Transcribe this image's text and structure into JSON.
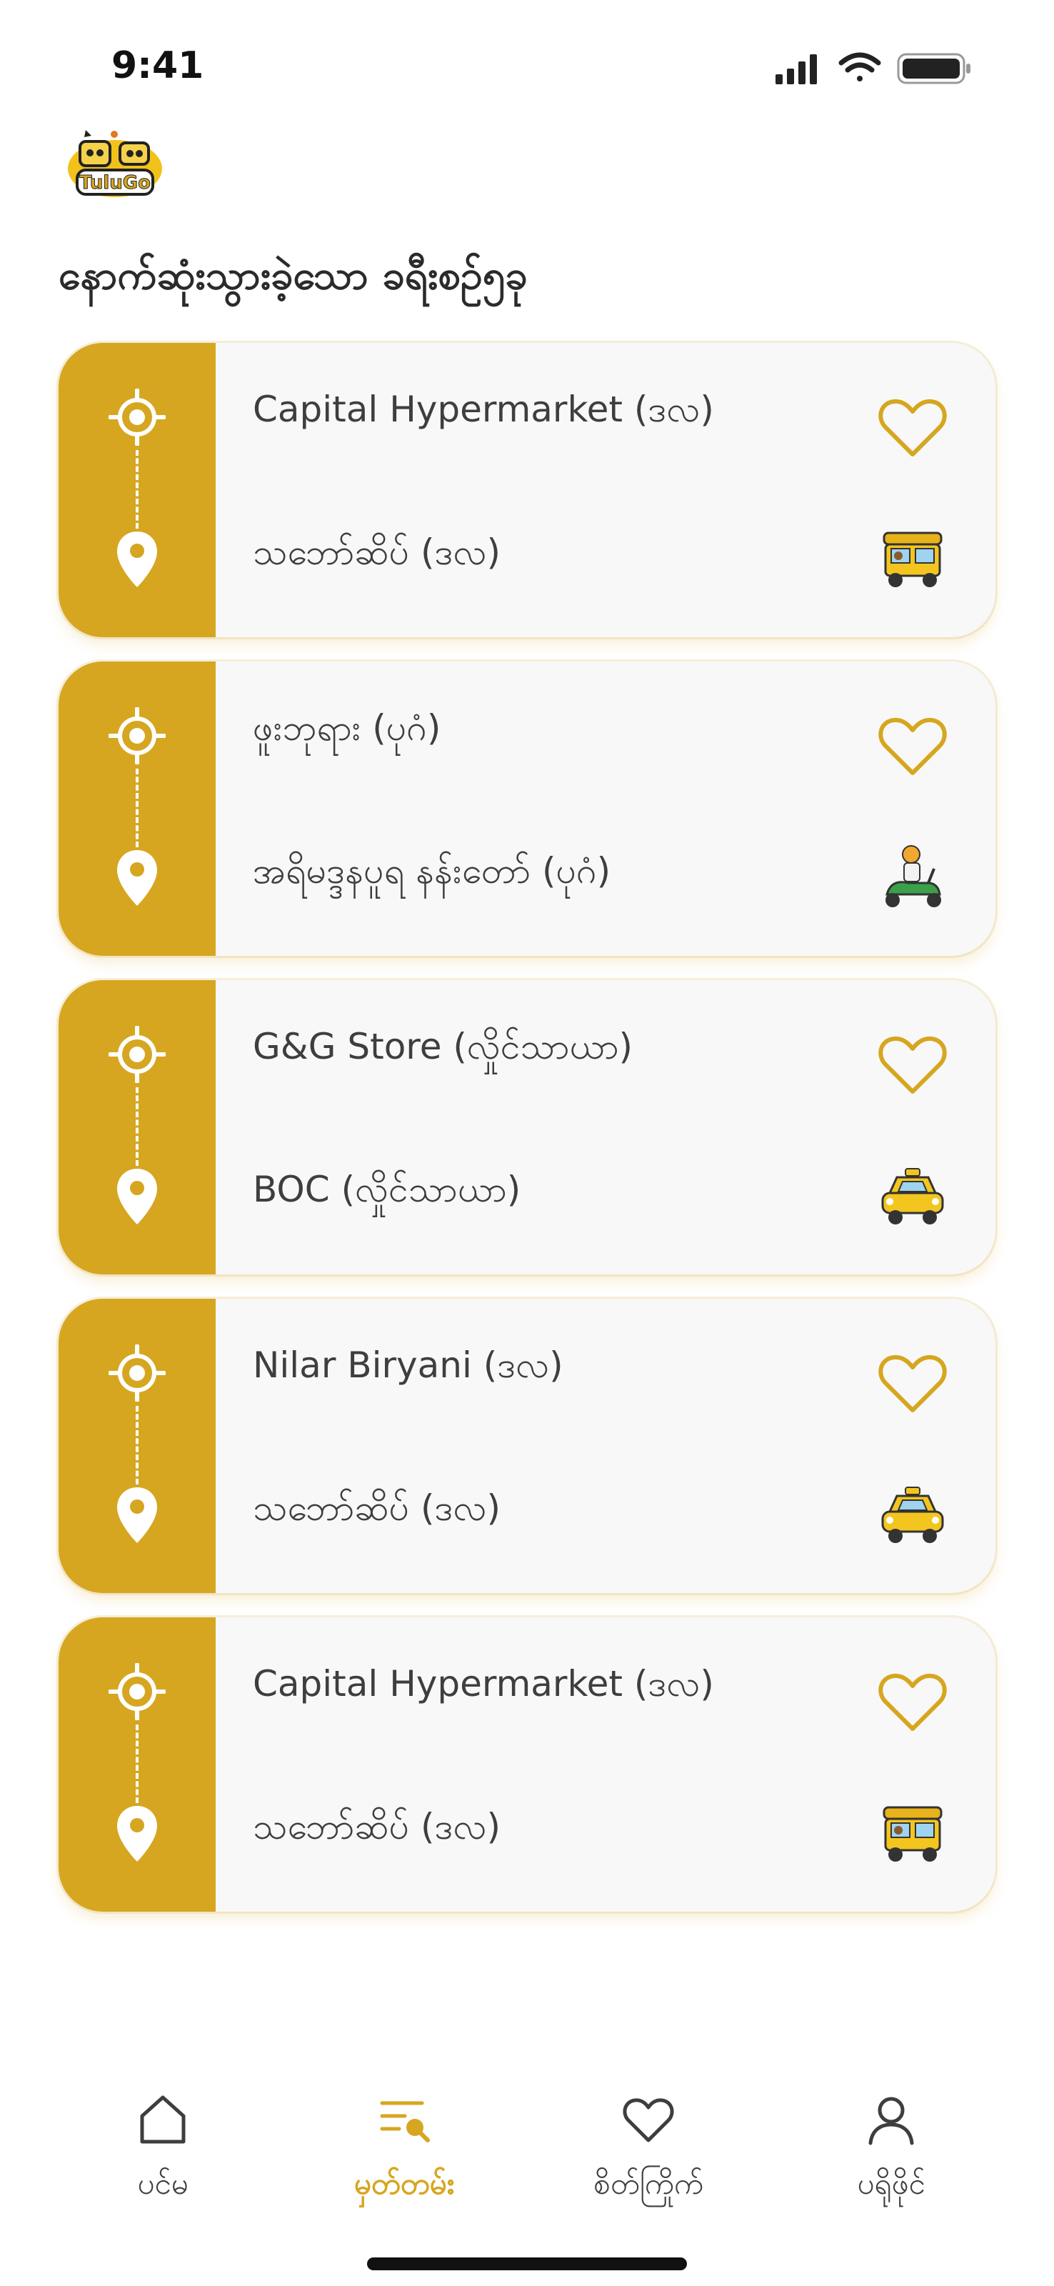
{
  "status_bar": {
    "time": "9:41"
  },
  "brand": {
    "logo_text": "TuluGo",
    "accent_color": "#d6a620"
  },
  "page": {
    "title": "နောက်ဆုံးသွားခဲ့သော ခရီးစဉ်၅ခု"
  },
  "trips": [
    {
      "origin": "Capital Hypermarket (ဒလ)",
      "destination": "သဘော်ဆိပ် (ဒလ)",
      "vehicle_icon": "tuk-tuk-icon"
    },
    {
      "origin": "ဖူးဘုရား (ပုဂံ)",
      "destination": "အရိမဒ္ဒနပူရ နန်းတော် (ပုဂံ)",
      "vehicle_icon": "scooter-rider-icon"
    },
    {
      "origin": "G&G Store (လှိုင်သာယာ)",
      "destination": "BOC (လှိုင်သာယာ)",
      "vehicle_icon": "taxi-icon"
    },
    {
      "origin": "Nilar Biryani (ဒလ)",
      "destination": "သဘော်ဆိပ် (ဒလ)",
      "vehicle_icon": "taxi-icon"
    },
    {
      "origin": "Capital Hypermarket (ဒလ)",
      "destination": "သဘော်ဆိပ် (ဒလ)",
      "vehicle_icon": "tuk-tuk-icon"
    }
  ],
  "nav": {
    "home": "ပင်မ",
    "records": "မှတ်တမ်း",
    "favorites": "စိတ်ကြိုက်",
    "profile": "ပရိုဖိုင်"
  }
}
